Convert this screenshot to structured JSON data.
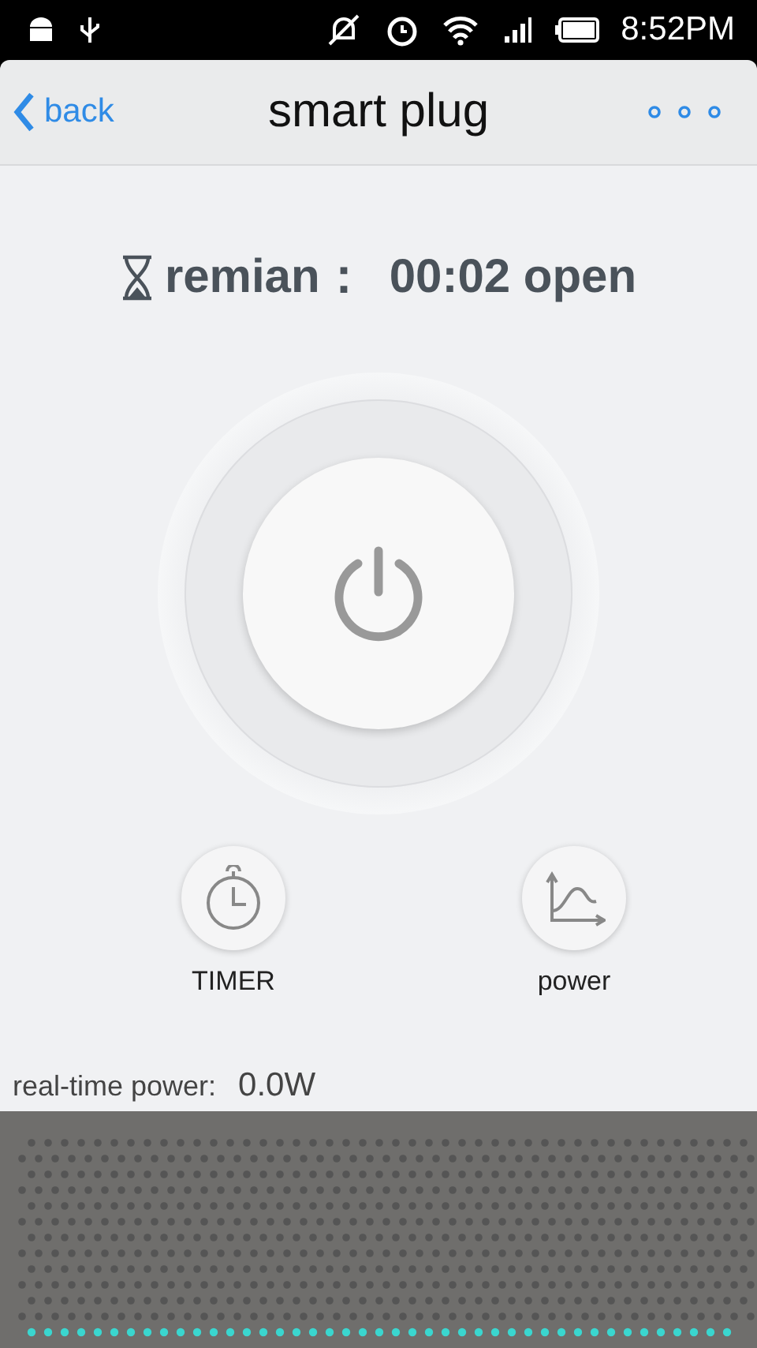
{
  "status_bar": {
    "time": "8:52PM"
  },
  "header": {
    "back": "back",
    "title": "smart plug"
  },
  "countdown": {
    "label": "remian：",
    "value": "00:02 open"
  },
  "actions": [
    {
      "kind": "timer",
      "label": "TIMER"
    },
    {
      "kind": "chart",
      "label": "power"
    }
  ],
  "realtime_power": {
    "label": "real-time power:",
    "value": "0.0W"
  }
}
